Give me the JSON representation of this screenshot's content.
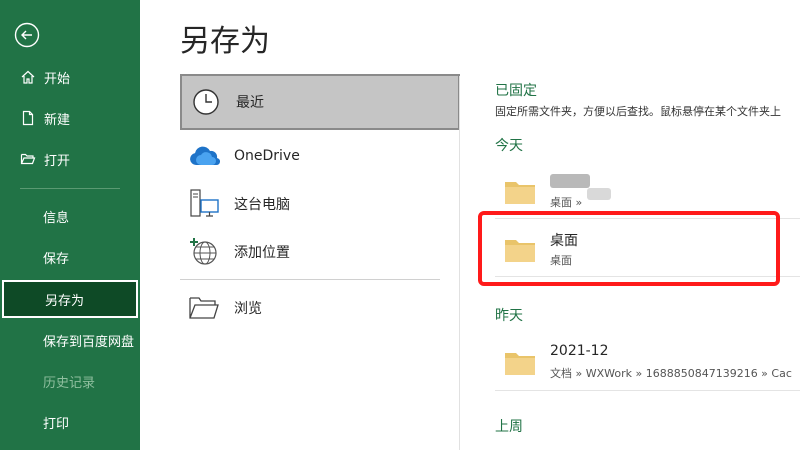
{
  "sidebar": {
    "items": [
      {
        "label": "开始",
        "icon": "home-icon"
      },
      {
        "label": "新建",
        "icon": "new-document-icon"
      },
      {
        "label": "打开",
        "icon": "open-folder-icon"
      },
      {
        "label": "信息"
      },
      {
        "label": "保存"
      },
      {
        "label": "另存为",
        "active": true
      },
      {
        "label": "保存到百度网盘"
      },
      {
        "label": "历史记录",
        "disabled": true
      },
      {
        "label": "打印"
      }
    ]
  },
  "main": {
    "title": "另存为",
    "locations": [
      {
        "label": "最近",
        "icon": "clock-icon",
        "selected": true
      },
      {
        "label": "OneDrive",
        "icon": "onedrive-cloud-icon"
      },
      {
        "label": "这台电脑",
        "icon": "computer-icon"
      },
      {
        "label": "添加位置",
        "icon": "globe-add-icon"
      },
      {
        "label": "浏览",
        "icon": "browse-folder-icon"
      }
    ]
  },
  "recent": {
    "pinned_heading": "已固定",
    "pinned_desc": "固定所需文件夹，方便以后查找。鼠标悬停在某个文件夹上",
    "today_heading": "今天",
    "yesterday_heading": "昨天",
    "last_week_heading": "上周",
    "today_items": [
      {
        "name": "",
        "path": "桌面 »"
      },
      {
        "name": "桌面",
        "path": "桌面"
      }
    ],
    "yesterday_items": [
      {
        "name": "2021-12",
        "path": "文档 » WXWork » 1688850847139216 » Cac"
      }
    ]
  },
  "colors": {
    "sidebar_bg": "#217346",
    "sidebar_active_bg": "#0e4a26",
    "accent_green": "#217346",
    "highlight_red": "#ff1a1a",
    "folder_yellow": "#f3d38a"
  }
}
